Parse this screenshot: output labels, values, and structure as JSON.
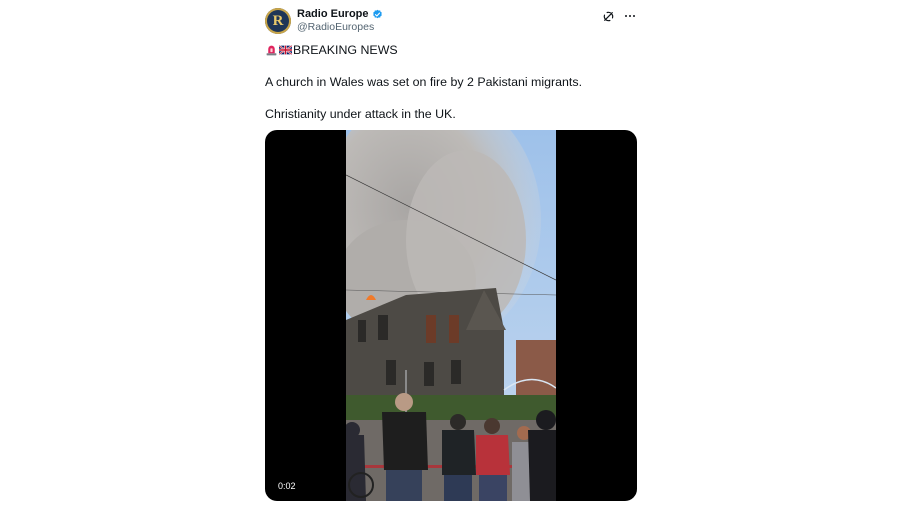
{
  "tweet": {
    "author": {
      "display_name": "Radio Europe",
      "handle": "@RadioEuropes",
      "avatar_letter": "R",
      "verified": true
    },
    "text": {
      "line1": "BREAKING NEWS",
      "line1_emojis": [
        "rotating-light",
        "uk-flag"
      ],
      "line2": "A church in Wales was set on fire by 2 Pakistani migrants.",
      "line3": "Christianity under attack in the UK."
    },
    "media": {
      "type": "video",
      "timecode": "0:02"
    },
    "actions": [
      "grok-icon",
      "more-icon"
    ]
  },
  "colors": {
    "verified_blue": "#1d9bf0",
    "secondary_text": "#536471",
    "avatar_bg": "#1f3657",
    "avatar_gold": "#c9a64a"
  }
}
